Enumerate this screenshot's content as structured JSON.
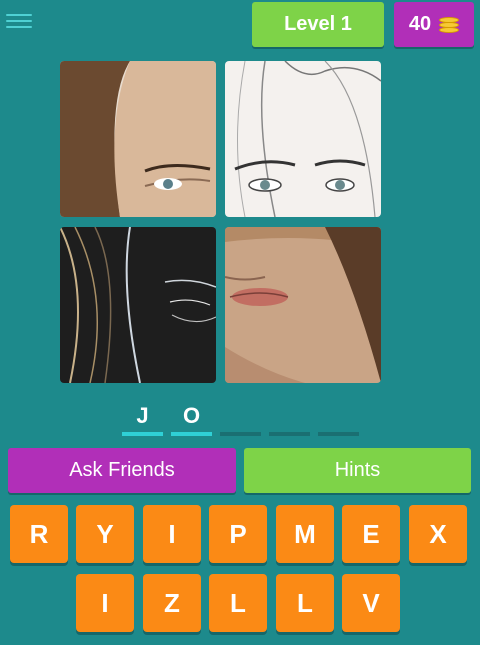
{
  "header": {
    "level_label": "Level 1",
    "coins": "40"
  },
  "answer": {
    "letters": [
      "J",
      "O",
      "",
      "",
      ""
    ]
  },
  "actions": {
    "ask_friends": "Ask Friends",
    "hints": "Hints"
  },
  "keyboard": {
    "row1": [
      "R",
      "Y",
      "I",
      "P",
      "M",
      "E",
      "X"
    ],
    "row2": [
      "I",
      "Z",
      "L",
      "L",
      "V"
    ]
  },
  "colors": {
    "background": "#1d8a8c",
    "green": "#7ed348",
    "purple": "#b12fb8",
    "orange": "#fb8a15",
    "slot_active": "#2fd0d6"
  },
  "icons": {
    "menu": "hamburger-menu-icon",
    "coins": "coin-stack-icon"
  }
}
